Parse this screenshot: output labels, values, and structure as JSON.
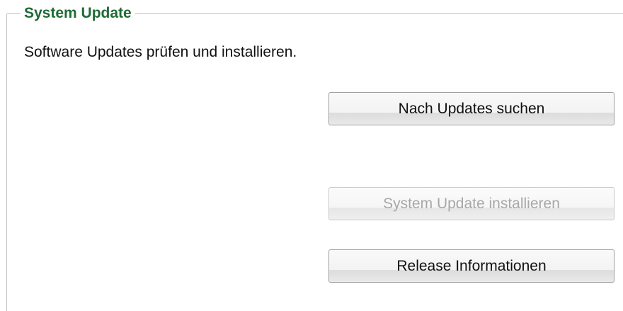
{
  "section": {
    "title": "System Update",
    "description": "Software Updates prüfen und installieren."
  },
  "buttons": {
    "search": {
      "label": "Nach Updates suchen",
      "enabled": true
    },
    "install": {
      "label": "System Update installieren",
      "enabled": false
    },
    "release": {
      "label": "Release Informationen",
      "enabled": true
    }
  },
  "colors": {
    "legend": "#1e6b35",
    "border": "#c4c4c4",
    "disabled_text": "#a8a8a8"
  }
}
